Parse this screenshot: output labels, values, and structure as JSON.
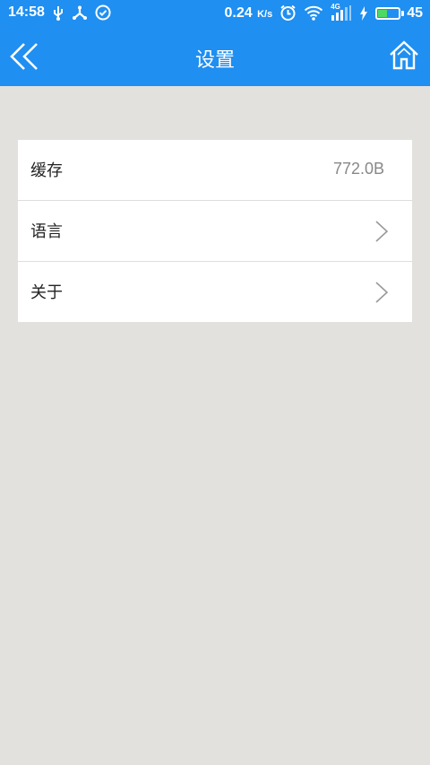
{
  "status_bar": {
    "time": "14:58",
    "speed": "0.24",
    "speed_unit": "K/s",
    "network": "4G",
    "battery": "45",
    "battery_level_percent": 45
  },
  "header": {
    "title": "设置",
    "back_icon": "double-chevron-left-icon",
    "home_icon": "home-icon"
  },
  "settings": {
    "items": [
      {
        "label": "缓存",
        "value": "772.0B"
      },
      {
        "label": "语言",
        "icon": "chevron-right-icon"
      },
      {
        "label": "关于",
        "icon": "chevron-right-icon"
      }
    ]
  },
  "colors": {
    "header_bg": "#1f8ff1",
    "page_bg": "#e2e1dd",
    "card_bg": "#ffffff",
    "battery_fill": "#4cd964"
  }
}
